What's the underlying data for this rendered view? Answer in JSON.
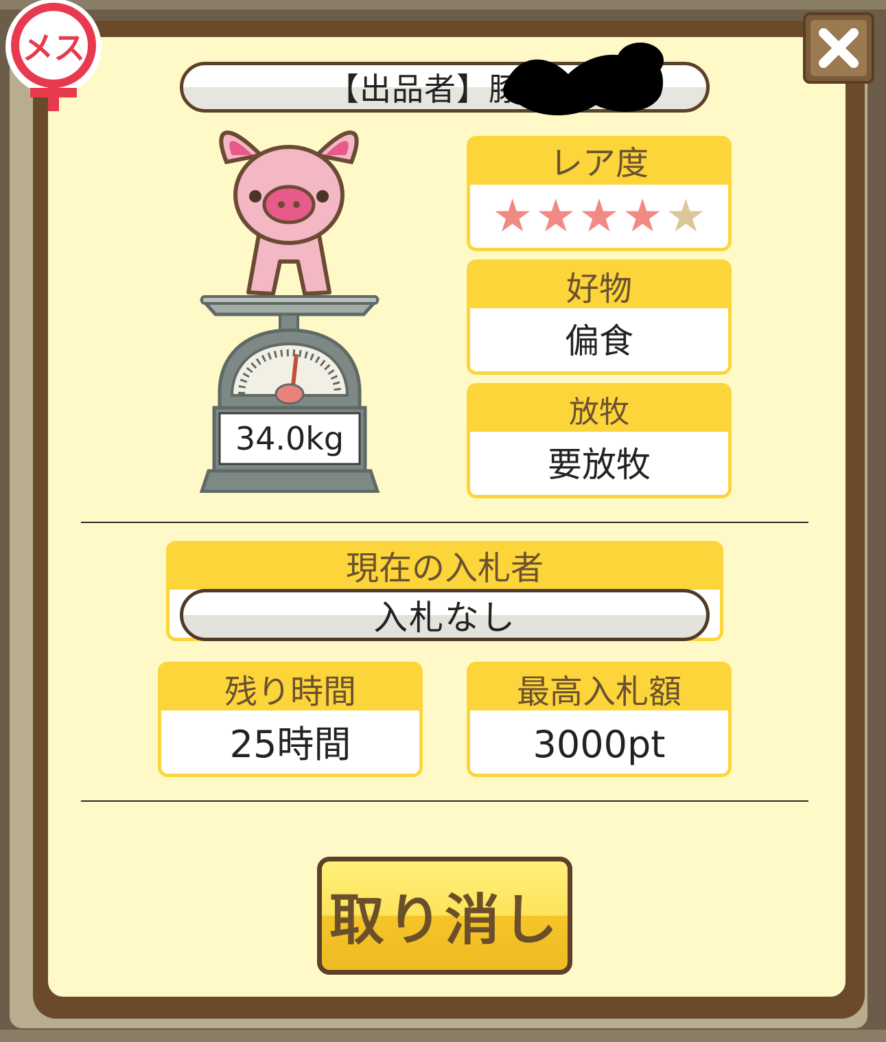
{
  "badge": {
    "label": "メス",
    "color": "#e83a4e"
  },
  "close_icon": "close-x-icon",
  "seller": {
    "text": "【出品者】豚"
  },
  "pig": {
    "weight": "34.0kg"
  },
  "rarity": {
    "title": "レア度",
    "filled": 4,
    "total": 5,
    "filled_color": "#f08a82",
    "empty_color": "#d9c79a"
  },
  "favorite": {
    "title": "好物",
    "value": "偏食"
  },
  "grazing": {
    "title": "放牧",
    "value": "要放牧"
  },
  "bidder": {
    "title": "現在の入札者",
    "value": "入札なし"
  },
  "remaining": {
    "title": "残り時間",
    "value": "25時間"
  },
  "highest_bid": {
    "title": "最高入札額",
    "value": "3000pt"
  },
  "cancel_button": {
    "label": "取り消し"
  }
}
